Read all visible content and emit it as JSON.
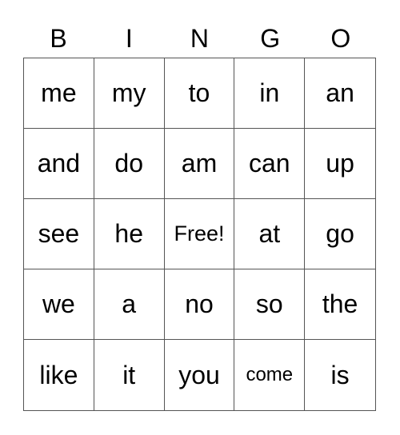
{
  "header": [
    "B",
    "I",
    "N",
    "G",
    "O"
  ],
  "rows": [
    [
      "me",
      "my",
      "to",
      "in",
      "an"
    ],
    [
      "and",
      "do",
      "am",
      "can",
      "up"
    ],
    [
      "see",
      "he",
      "Free!",
      "at",
      "go"
    ],
    [
      "we",
      "a",
      "no",
      "so",
      "the"
    ],
    [
      "like",
      "it",
      "you",
      "come",
      "is"
    ]
  ]
}
